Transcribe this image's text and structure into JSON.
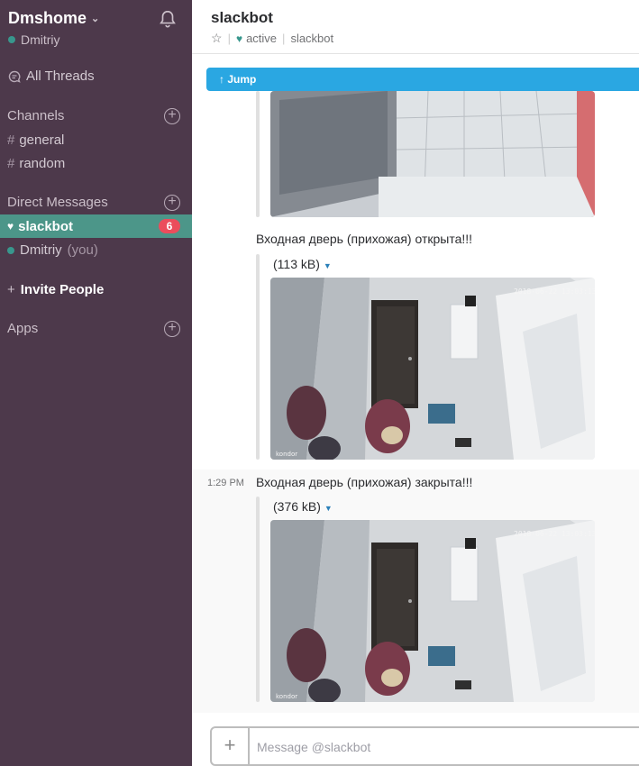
{
  "team": {
    "name": "Dmshome",
    "user": "Dmitriy"
  },
  "sidebar": {
    "all_threads": "All Threads",
    "channels_label": "Channels",
    "channels": [
      "general",
      "random"
    ],
    "dm_label": "Direct Messages",
    "dms": [
      {
        "name": "slackbot",
        "badge": "6"
      },
      {
        "name": "Dmitriy",
        "suffix": "(you)"
      }
    ],
    "invite": "Invite People",
    "apps_label": "Apps"
  },
  "header": {
    "channel": "slackbot",
    "status": "active",
    "subtitle": "slackbot"
  },
  "jump_label": "Jump",
  "messages": [
    {
      "text": "Входная дверь (прихожая) открыта!!!",
      "size": "(113 kB)"
    },
    {
      "time": "1:29 PM",
      "text": "Входная дверь (прихожая) закрыта!!!",
      "size": "(376 kB)"
    }
  ],
  "camera": {
    "timestamp": "2018-06-22 13:03:13",
    "brand": "kondor"
  },
  "composer": {
    "placeholder": "Message @slackbot"
  },
  "colors": {
    "sidebar": "#4d394b",
    "active": "#4c9689",
    "jump": "#2aa7e2",
    "badge": "#eb4d5c"
  }
}
